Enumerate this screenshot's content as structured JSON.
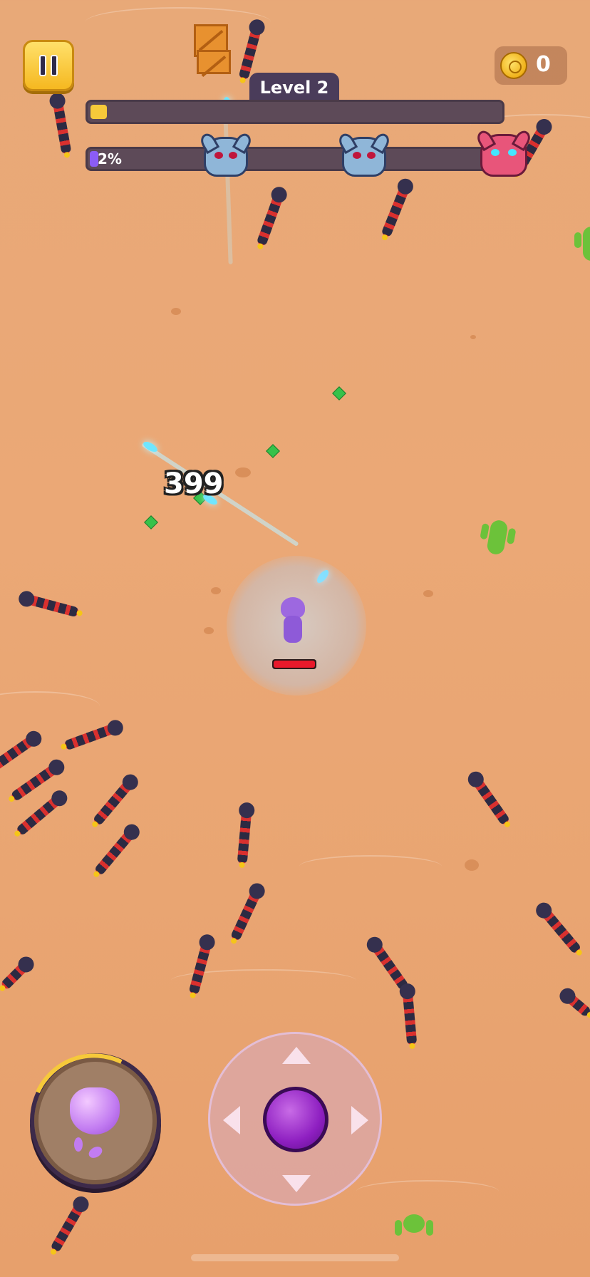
{
  "hud": {
    "level_label": "Level 2",
    "coin_count": "0",
    "xp_progress": 0.04,
    "wave_progress": 0.02,
    "wave_percent": "2%",
    "boss_markers": [
      "blue-skull",
      "blue-skull",
      "red-skull"
    ]
  },
  "combat": {
    "damage_number": "399",
    "player_health": 1.0
  },
  "controls": {
    "skill_icon": "purple-slime-icon",
    "skill_cooldown_progress": 0.15,
    "joystick_icon": "joystick-icon"
  },
  "colors": {
    "sand": "#eba876",
    "player": "#9d68e0",
    "xp": "#f6c93a",
    "wave": "#8b5cf6",
    "health": "#e8192b",
    "snake_body": "#2c2a42",
    "snake_stripe": "#d9302e"
  }
}
